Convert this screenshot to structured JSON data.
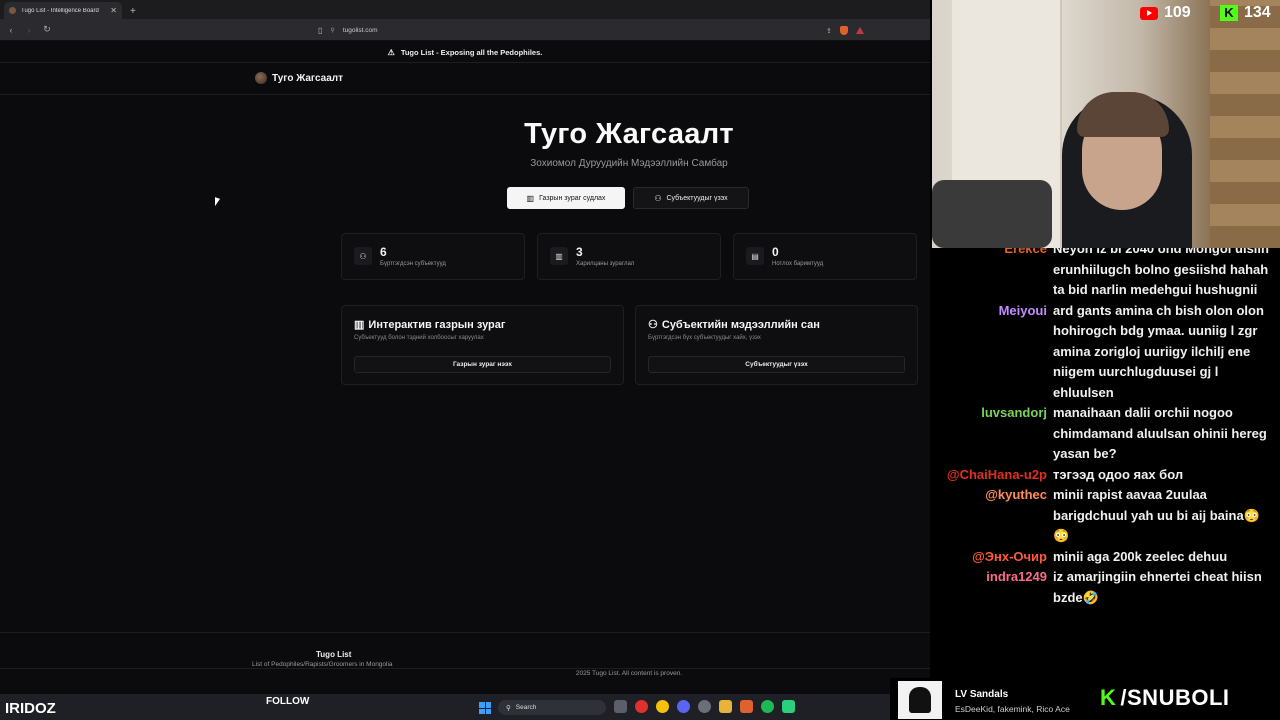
{
  "browser": {
    "tab_title": "Tugo List - Intelligence Board",
    "url": "tugolist.com"
  },
  "banner": {
    "text": "Tugo List - Exposing all the Pedophiles."
  },
  "header": {
    "brand": "Туго Жагсаалт"
  },
  "hero": {
    "title": "Туго Жагсаалт",
    "subtitle": "Зохиомол Дуруудийн Мэдээллийн Самбар",
    "btn_map": "Газрын зураг судлах",
    "btn_subjects": "Субъектуудыг үзэх"
  },
  "stats": [
    {
      "value": "6",
      "label": "Бүртгэгдсэн субъектууд",
      "icon": "users-icon"
    },
    {
      "value": "3",
      "label": "Харилцаны зураглал",
      "icon": "map-icon"
    },
    {
      "value": "0",
      "label": "Нотлох баримтууд",
      "icon": "document-icon"
    }
  ],
  "cards": [
    {
      "title": "Интерактив газрын зураг",
      "desc": "Субъектууд болон тэдний холбоосыг харуулах",
      "button": "Газрын зураг нээх"
    },
    {
      "title": "Субъектийн мэдээллийн сан",
      "desc": "Бүртгэгдсэн бүх субъектуудыг хайх, үзэх",
      "button": "Субъектуудыг үзэх"
    }
  ],
  "footer": {
    "title": "Tugo List",
    "desc": "List of Pedophiles/Rapists/Groomers in Mongolia",
    "copyright": "2025 Tugo List. All content is proven."
  },
  "stream": {
    "youtube_count": "109",
    "kick_count": "134",
    "streamer": "IRIDOZ",
    "follow": "FOLLOW",
    "sub_name": "LV Sandals",
    "sub_desc": "EsDeeKid, fakemink, Rico Ace",
    "brand": "/SNUBOLI"
  },
  "chat": [
    {
      "name": "Erekce",
      "color": "#e0602e",
      "text": "Neyon iz bi 2040 ond Mongol ulsiin"
    },
    {
      "name": "",
      "color": "#ffffff",
      "text": "erunhiilugch bolno gesiishd hahah"
    },
    {
      "name": "",
      "color": "#ffffff",
      "text": "ta bid narlin medehgui hushugnii"
    },
    {
      "name": "Meiyoui",
      "color": "#c28cff",
      "text": "ard gants amina ch bish olon olon"
    },
    {
      "name": "",
      "color": "#ffffff",
      "text": "hohirogch bdg ymaa. uuniig l zgr"
    },
    {
      "name": "",
      "color": "#ffffff",
      "text": "amina zorigloj uuriigy ilchilj ene"
    },
    {
      "name": "",
      "color": "#ffffff",
      "text": "niigem uurchlugduusei gj l"
    },
    {
      "name": "",
      "color": "#ffffff",
      "text": "ehluulsen"
    },
    {
      "name": "luvsandorj",
      "color": "#7cd35a",
      "text": "manaihaan dalii orchii nogoo"
    },
    {
      "name": "",
      "color": "#ffffff",
      "text": "chimdamand aluulsan ohinii hereg"
    },
    {
      "name": "",
      "color": "#ffffff",
      "text": "yasan be?"
    },
    {
      "name": "@ChaiHana-u2p",
      "color": "#e0301e",
      "text": "тэгээд одоо яах бол"
    },
    {
      "name": "@kyuthec",
      "color": "#ff8c5a",
      "text": "minii rapist aavaa 2uulaa"
    },
    {
      "name": "",
      "color": "#ffffff",
      "text": "barigdchuul yah uu bi aij baina😳"
    },
    {
      "name": "",
      "color": "#ffffff",
      "text": "😳"
    },
    {
      "name": "@Энх-Очир",
      "color": "#ff5a3a",
      "text": "minii aga 200k zeelec dehuu"
    },
    {
      "name": "indra1249",
      "color": "#ff6b8a",
      "text": "iz amarjingiin ehnertei cheat hiisn"
    },
    {
      "name": "",
      "color": "#ffffff",
      "text": "bzde🤣"
    }
  ],
  "taskbar": {
    "search": "Search"
  }
}
